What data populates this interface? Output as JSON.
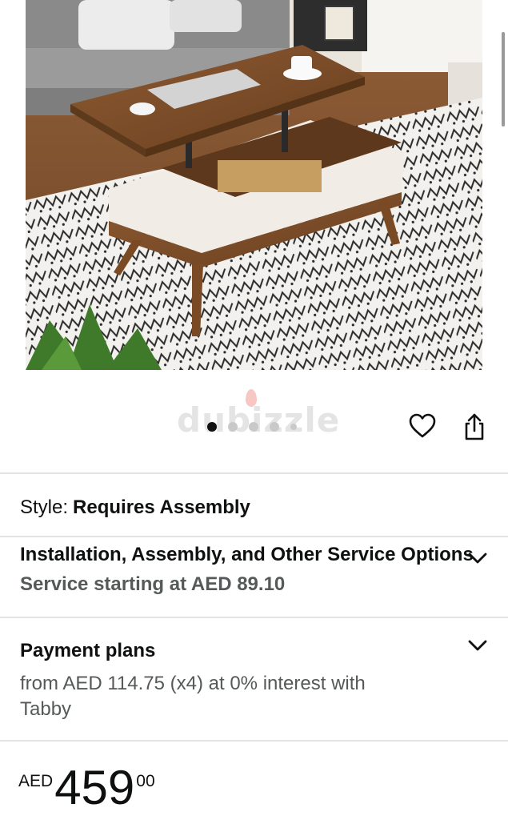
{
  "carousel": {
    "watermark": "dubizzle",
    "dot_count": 5,
    "active_index": 0
  },
  "style": {
    "label": "Style:",
    "value": "Requires Assembly"
  },
  "service": {
    "title": "Installation, Assembly, and Other Service Options",
    "subtitle": "Service starting at AED 89.10"
  },
  "payment": {
    "title": "Payment plans",
    "description": "from AED 114.75 (x4) at 0% interest with Tabby"
  },
  "price": {
    "currency": "AED",
    "whole": "459",
    "fraction": "00"
  },
  "colors": {
    "text_primary": "#0f1111",
    "text_secondary": "#565959",
    "divider": "#e3e3e3",
    "dot_active": "#111111",
    "dot_inactive": "#c9c9c9"
  },
  "icons": [
    "heart-icon",
    "share-icon",
    "chevron-down-icon"
  ]
}
